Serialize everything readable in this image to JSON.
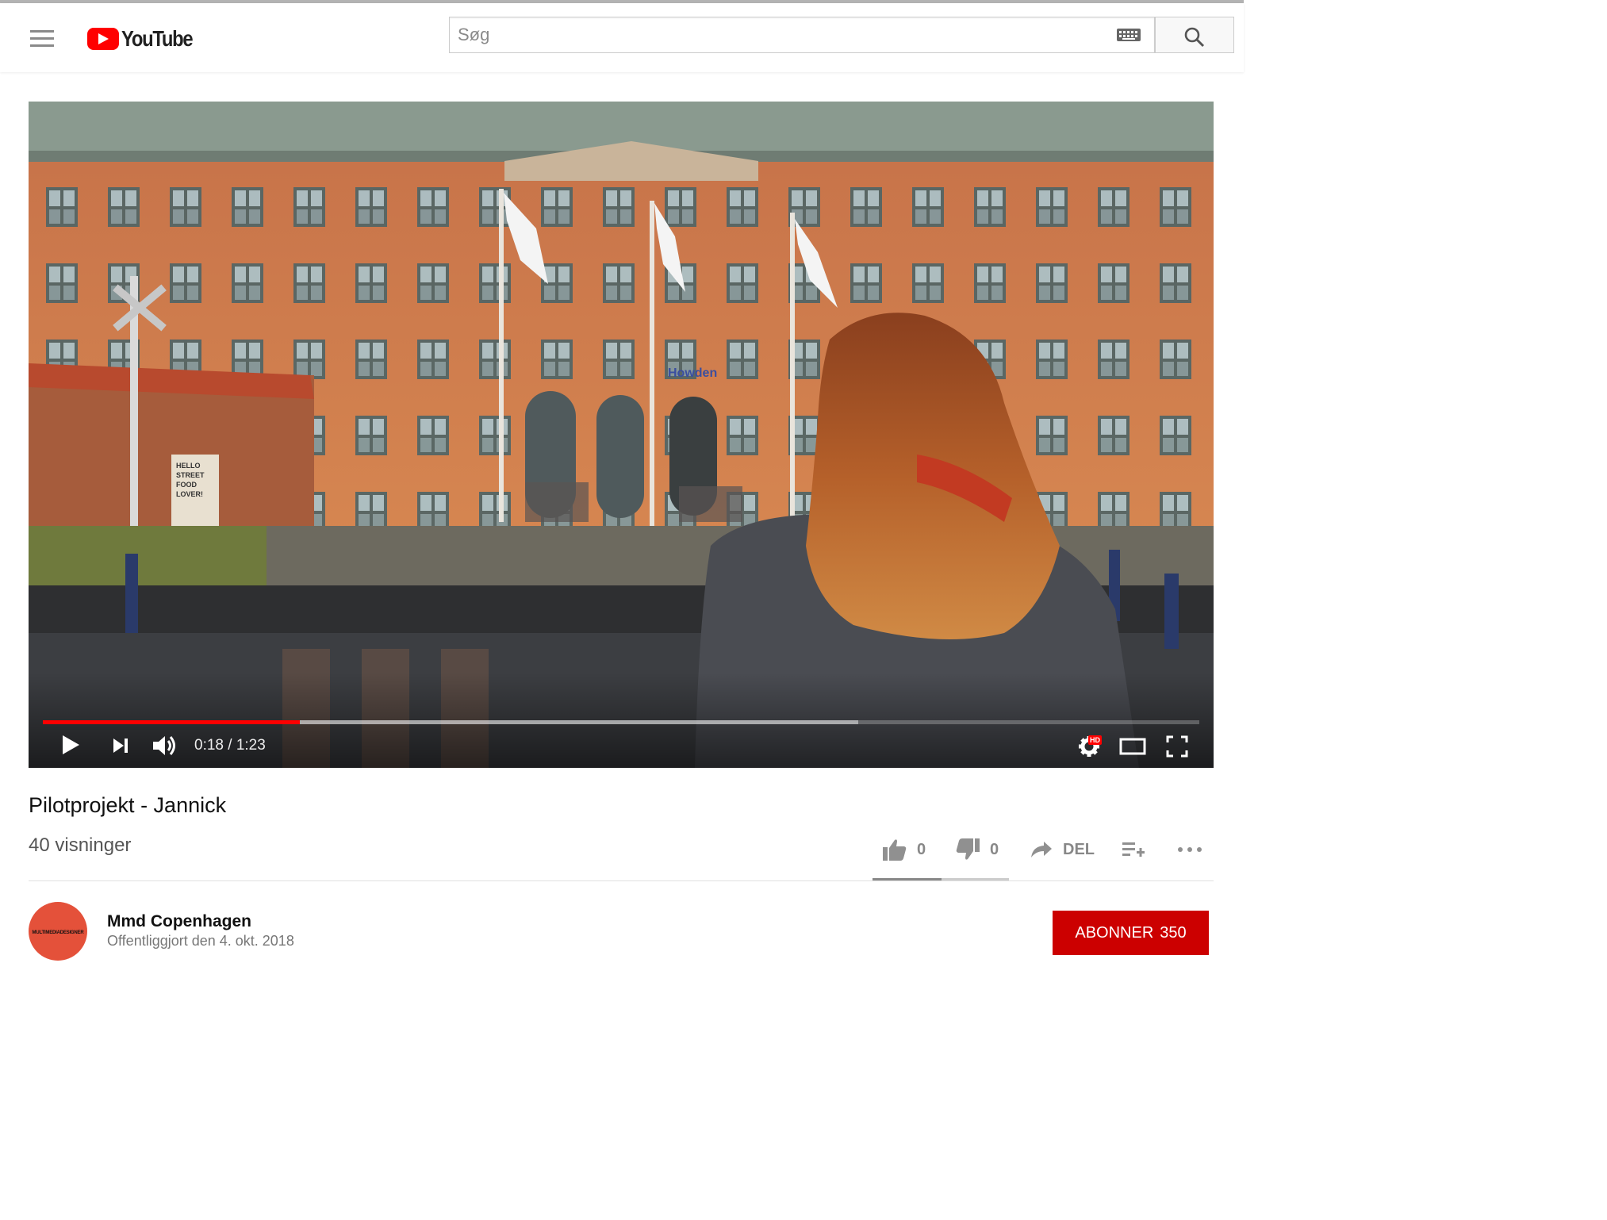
{
  "header": {
    "logo_text": "YouTube",
    "search_placeholder": "Søg"
  },
  "player": {
    "current_time": "0:18",
    "separator": " / ",
    "duration": "1:23",
    "progress_fraction": 0.222,
    "buffered_fraction": 0.705,
    "hd_badge": "HD",
    "scene_sign": "Howden",
    "scene_board": [
      "HELLO",
      "STREET",
      "FOOD",
      "LOVER!"
    ]
  },
  "video": {
    "title": "Pilotprojekt - Jannick",
    "views": "40 visninger"
  },
  "actions": {
    "like_count": "0",
    "dislike_count": "0",
    "share_label": "DEL"
  },
  "channel": {
    "name": "Mmd Copenhagen",
    "published": "Offentliggjort den 4. okt. 2018",
    "avatar_text": "MULTIMEDIADESIGNER",
    "subscribe_label": "ABONNER",
    "subscriber_count": "350"
  },
  "colors": {
    "brand_red": "#ff0000",
    "subscribe_red": "#cc0000",
    "progress_red": "#ff0000"
  }
}
